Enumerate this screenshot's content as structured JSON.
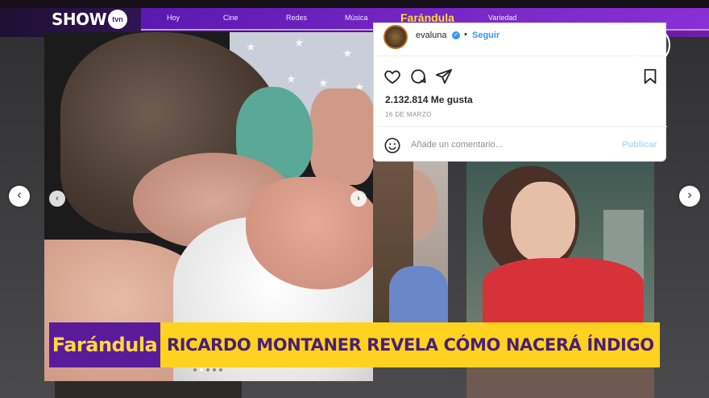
{
  "header": {
    "logo_text": "SHOW",
    "logo_badge": "tvn",
    "nav": [
      {
        "label": "Hoy"
      },
      {
        "label": "Cine"
      },
      {
        "label": "Redes"
      },
      {
        "label": "Música"
      },
      {
        "label": "Farándula",
        "active": true
      },
      {
        "label": "Variedad"
      }
    ],
    "colors": {
      "nav_bg": "#5b19b0",
      "active": "#ffd93a"
    }
  },
  "instagram": {
    "username": "evaluna",
    "separator": "•",
    "follow_label": "Seguir",
    "verified_icon": "verified-badge-icon",
    "likes": "2.132.814 Me gusta",
    "date": "16 DE MARZO",
    "comment_placeholder": "Añade un comentario...",
    "publish_label": "Publicar",
    "icons": [
      "heart-icon",
      "comment-icon",
      "share-icon",
      "bookmark-icon",
      "emoji-icon"
    ]
  },
  "carousel": {
    "prev_label": "‹",
    "next_label": "›",
    "slide_count": 5,
    "active_slide": 2
  },
  "gallery": {
    "prev_label": "‹",
    "next_label": "›"
  },
  "watermark": "tvn",
  "lower_third": {
    "tag": "Farándula",
    "headline": "RICARDO MONTANER REVELA CÓMO NACERÁ ÍNDIGO",
    "colors": {
      "tag_bg": "#5a1b9a",
      "tag_text": "#ffd93a",
      "headline_bg": "#ffd21f",
      "headline_text": "#4a1f78"
    }
  }
}
